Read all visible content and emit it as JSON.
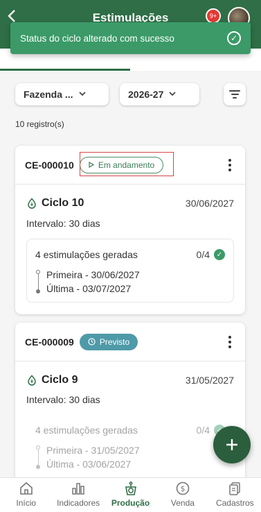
{
  "header": {
    "title": "Estimulações",
    "back_icon": "chevron-left-icon",
    "notifications_badge": "9+"
  },
  "toast": {
    "message": "Status do ciclo alterado com sucesso",
    "icon": "check-circle-icon",
    "color": "#3b9a68"
  },
  "filters": {
    "farm": "Fazenda ...",
    "season": "2026-27"
  },
  "records_count": "10 registro(s)",
  "cards": [
    {
      "code": "CE-000010",
      "status": "Em andamento",
      "status_icon": "play-icon",
      "cycle": "Ciclo 10",
      "date": "30/06/2027",
      "interval": "Intervalo: 30 dias",
      "generated": "4 estimulações geradas",
      "progress": "0/4",
      "first": "Primeira - 30/06/2027",
      "last": "Última - 03/07/2027"
    },
    {
      "code": "CE-000009",
      "status": "Previsto",
      "status_icon": "clock-icon",
      "cycle": "Ciclo 9",
      "date": "31/05/2027",
      "interval": "Intervalo: 30 dias",
      "generated": "4 estimulações geradas",
      "progress": "0/4",
      "first": "Primeira - 31/05/2027",
      "last": "Última - 03/06/2027"
    }
  ],
  "nav": [
    {
      "label": "Início",
      "icon": "home-icon"
    },
    {
      "label": "Indicadores",
      "icon": "bar-chart-icon"
    },
    {
      "label": "Produção",
      "icon": "scale-icon"
    },
    {
      "label": "Venda",
      "icon": "dollar-icon"
    },
    {
      "label": "Cadastros",
      "icon": "documents-icon"
    }
  ],
  "colors": {
    "primary": "#2f6e46",
    "accent": "#3b9a68",
    "planned": "#4f9aa8"
  }
}
